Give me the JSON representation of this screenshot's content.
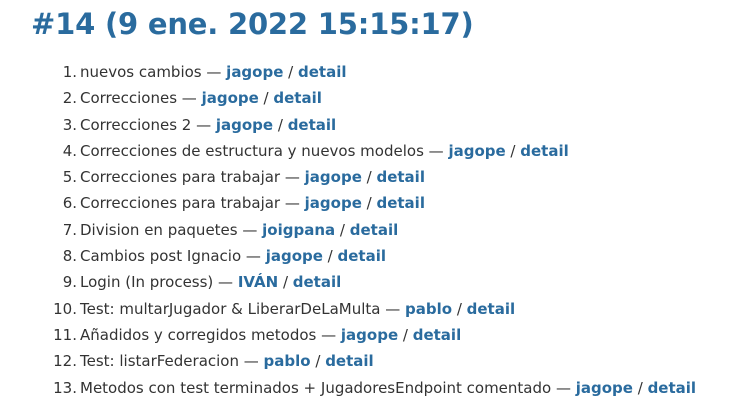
{
  "page": {
    "title": "#14 (9 ene. 2022 15:15:17)"
  },
  "separators": {
    "dash": " — ",
    "slash": " / "
  },
  "changes": [
    {
      "num": "1.",
      "message": "nuevos cambios",
      "author": "jagope",
      "detail": "detail"
    },
    {
      "num": "2.",
      "message": "Correcciones",
      "author": "jagope",
      "detail": "detail"
    },
    {
      "num": "3.",
      "message": "Correcciones 2",
      "author": "jagope",
      "detail": "detail"
    },
    {
      "num": "4.",
      "message": "Correcciones de estructura y nuevos modelos",
      "author": "jagope",
      "detail": "detail"
    },
    {
      "num": "5.",
      "message": "Correcciones para trabajar",
      "author": "jagope",
      "detail": "detail"
    },
    {
      "num": "6.",
      "message": "Correcciones para trabajar",
      "author": "jagope",
      "detail": "detail"
    },
    {
      "num": "7.",
      "message": "Division en paquetes",
      "author": "joigpana",
      "detail": "detail"
    },
    {
      "num": "8.",
      "message": "Cambios post Ignacio",
      "author": "jagope",
      "detail": "detail"
    },
    {
      "num": "9.",
      "message": "Login (In process)",
      "author": "IVÁN",
      "detail": "detail"
    },
    {
      "num": "10.",
      "message": "Test: multarJugador & LiberarDeLaMulta",
      "author": "pablo",
      "detail": "detail"
    },
    {
      "num": "11.",
      "message": "Añadidos y corregidos metodos",
      "author": "jagope",
      "detail": "detail"
    },
    {
      "num": "12.",
      "message": "Test: listarFederacion",
      "author": "pablo",
      "detail": "detail"
    },
    {
      "num": "13.",
      "message": "Metodos con test terminados + JugadoresEndpoint comentado",
      "author": "jagope",
      "detail": "detail"
    }
  ],
  "colors": {
    "link": "#2a6b9e",
    "text": "#333333"
  }
}
